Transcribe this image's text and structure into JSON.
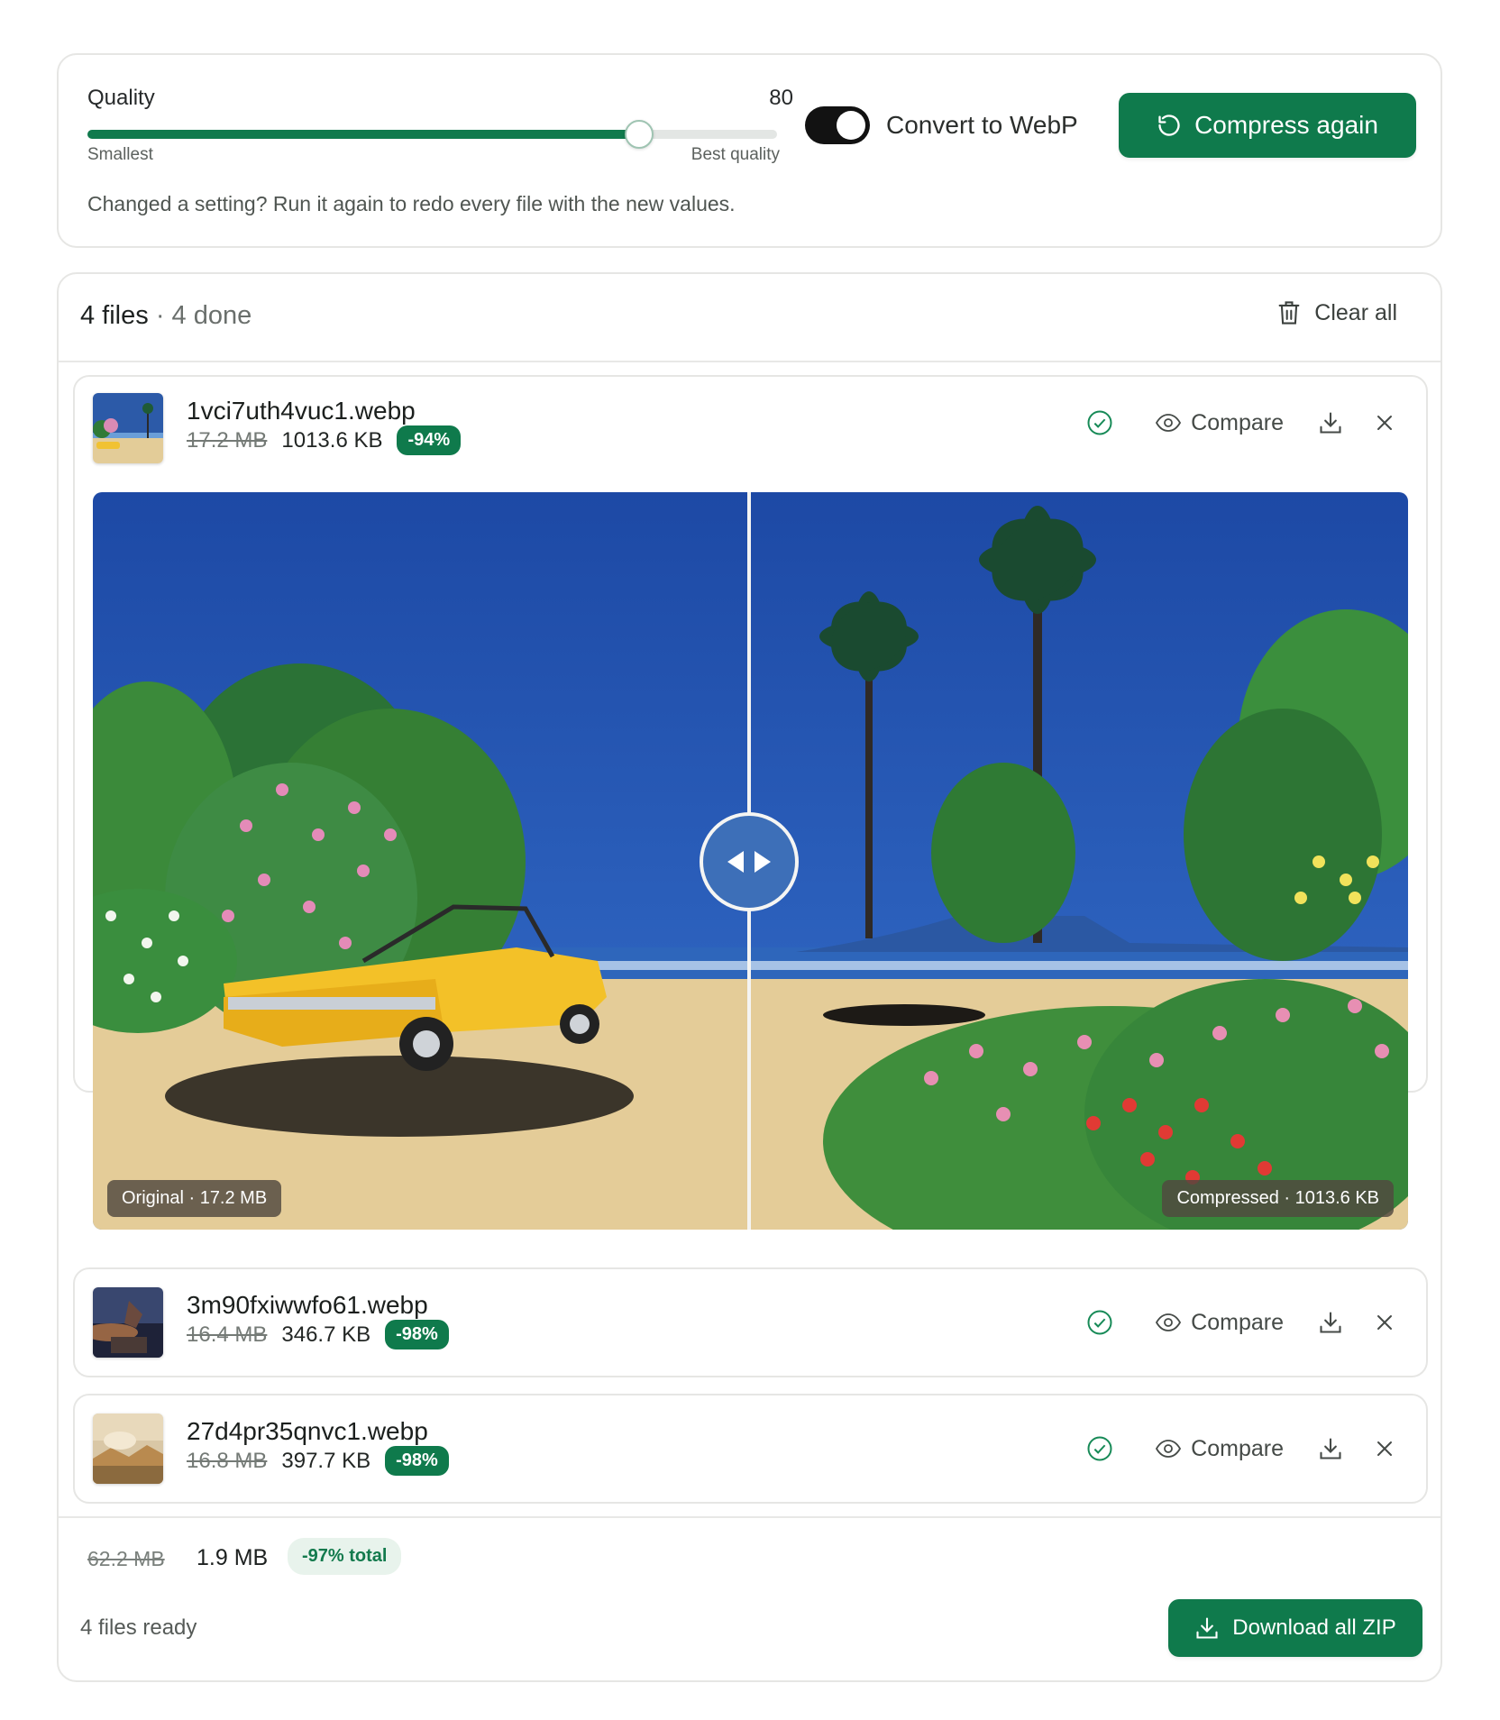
{
  "settings": {
    "quality_label": "Quality",
    "quality_value": "80",
    "quality_fraction": 0.8,
    "min_label": "Smallest",
    "max_label": "Best quality",
    "hint": "Changed a setting? Run it again to redo every file with the new values.",
    "webp_toggle_label": "Convert to WebP",
    "webp_enabled": true,
    "compress_button": "Compress again"
  },
  "files": {
    "count_label": "4 files",
    "done_label": "4 done",
    "clear_all": "Clear all",
    "compare_label": "Compare",
    "items": [
      {
        "name": "1vci7uth4vuc1.webp",
        "original": "17.2 MB",
        "compressed": "1013.6 KB",
        "saving": "-94%"
      },
      {
        "name": "3m90fxiwwfo61.webp",
        "original": "16.4 MB",
        "compressed": "346.7 KB",
        "saving": "-98%"
      },
      {
        "name": "27d4pr35qnvc1.webp",
        "original": "16.8 MB",
        "compressed": "397.7 KB",
        "saving": "-98%"
      }
    ],
    "viewer": {
      "original_tag": "Original · 17.2 MB",
      "compressed_tag": "Compressed · 1013.6 KB",
      "split_fraction": 0.5
    }
  },
  "footer": {
    "total_original": "62.2 MB",
    "total_compressed": "1.9 MB",
    "total_saving": "-97% total",
    "ready_label": "4 files ready",
    "download_zip": "Download all ZIP"
  },
  "colors": {
    "accent": "#0f7a4c",
    "badge_soft_bg": "#e8f3ec",
    "toggle_on": "#121212"
  }
}
